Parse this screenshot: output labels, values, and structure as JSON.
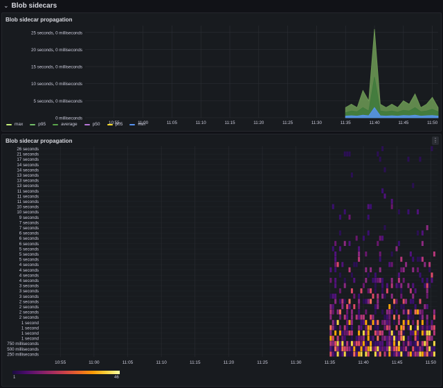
{
  "row": {
    "title": "Blob sidecars",
    "chevron": "⌄"
  },
  "panel1": {
    "title": "Blob sidecar propagation",
    "y_ticks": [
      "25 seconds, 0 milliseconds",
      "20 seconds, 0 milliseconds",
      "15 seconds, 0 milliseconds",
      "10 seconds, 0 milliseconds",
      "5 seconds, 0 milliseconds",
      "0 milliseconds"
    ],
    "x_ticks": [
      "10:55",
      "11:00",
      "11:05",
      "11:10",
      "11:15",
      "11:20",
      "11:25",
      "11:30",
      "11:35",
      "11:40",
      "11:45",
      "11:50"
    ],
    "legend": [
      {
        "label": "max",
        "color": "#c8f27a"
      },
      {
        "label": "p95",
        "color": "#73bf69"
      },
      {
        "label": "average",
        "color": "#5aa64b"
      },
      {
        "label": "p50",
        "color": "#b877d9"
      },
      {
        "label": "p05",
        "color": "#fade2a"
      },
      {
        "label": "min",
        "color": "#5794f2"
      }
    ]
  },
  "panel2": {
    "title": "Blob sidecar propagation",
    "menu_icon": "⋮",
    "y_ticks": [
      "26 seconds",
      "21 seconds",
      "17 seconds",
      "14 seconds",
      "14 seconds",
      "13 seconds",
      "13 seconds",
      "13 seconds",
      "11 seconds",
      "11 seconds",
      "11 seconds",
      "10 seconds",
      "10 seconds",
      "9 seconds",
      "7 seconds",
      "7 seconds",
      "6 seconds",
      "6 seconds",
      "6 seconds",
      "5 seconds",
      "5 seconds",
      "5 seconds",
      "4 seconds",
      "4 seconds",
      "4 seconds",
      "4 seconds",
      "3 seconds",
      "3 seconds",
      "3 seconds",
      "2 seconds",
      "2 seconds",
      "2 seconds",
      "2 seconds",
      "1 second",
      "1 second",
      "1 second",
      "1 second",
      "750 milliseconds",
      "500 milliseconds",
      "250 milliseconds"
    ],
    "x_ticks": [
      "10:55",
      "11:00",
      "11:05",
      "11:10",
      "11:15",
      "11:20",
      "11:25",
      "11:30",
      "11:35",
      "11:40",
      "11:45",
      "11:50"
    ],
    "colorbar": {
      "min": "1",
      "max": "46"
    }
  },
  "colors": {
    "background": "#111217",
    "panel": "#181b1f",
    "grid": "#2c2f35",
    "p95_fill": "#5e8c4a",
    "average_fill": "#3a6e3a",
    "min_fill": "#5794f2"
  },
  "chart_data": [
    {
      "type": "area",
      "title": "Blob sidecar propagation",
      "x": [
        "11:35",
        "11:36",
        "11:37",
        "11:38",
        "11:39",
        "11:40",
        "11:41",
        "11:42",
        "11:43",
        "11:44",
        "11:45",
        "11:46",
        "11:47",
        "11:48",
        "11:49",
        "11:50",
        "11:51"
      ],
      "series": [
        {
          "name": "p95",
          "values": [
            3,
            4,
            3,
            8,
            5,
            26,
            4,
            3,
            4,
            3,
            5,
            4,
            7,
            3,
            4,
            6,
            3
          ]
        },
        {
          "name": "average",
          "values": [
            1.5,
            2,
            1.8,
            3,
            2,
            12,
            2,
            1.8,
            2,
            1.7,
            2.2,
            2,
            3,
            1.8,
            2,
            2.5,
            1.8
          ]
        },
        {
          "name": "min",
          "values": [
            0.5,
            0.6,
            0.5,
            0.8,
            0.6,
            3,
            0.6,
            0.5,
            0.6,
            0.5,
            0.7,
            0.6,
            0.8,
            0.5,
            0.6,
            0.7,
            0.5
          ]
        }
      ],
      "ylabel": "",
      "ylim": [
        0,
        27
      ],
      "xlim": [
        "10:50",
        "11:51"
      ],
      "grid": true,
      "legend_position": "bottom-left"
    },
    {
      "type": "heatmap",
      "title": "Blob sidecar propagation",
      "x_range": [
        "11:35",
        "11:51"
      ],
      "color_range": [
        1,
        46
      ],
      "grid": true
    }
  ]
}
